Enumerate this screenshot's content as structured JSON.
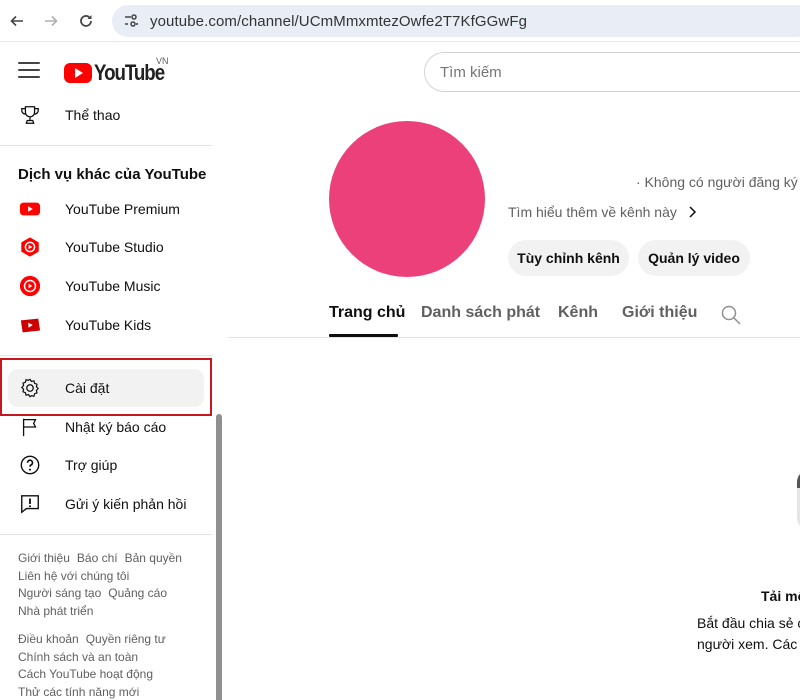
{
  "browser": {
    "url": "youtube.com/channel/UCmMmxmtezOwfe2T7KfGGwFg"
  },
  "masthead": {
    "logo_text": "YouTube",
    "country_code": "VN",
    "search_placeholder": "Tìm kiếm"
  },
  "sidebar": {
    "top_items": [
      {
        "label": "Thể thao",
        "icon": "trophy-icon"
      }
    ],
    "section_title": "Dịch vụ khác của YouTube",
    "services": [
      {
        "label": "YouTube Premium",
        "icon": "youtube-premium-icon"
      },
      {
        "label": "YouTube Studio",
        "icon": "youtube-studio-icon"
      },
      {
        "label": "YouTube Music",
        "icon": "youtube-music-icon"
      },
      {
        "label": "YouTube Kids",
        "icon": "youtube-kids-icon"
      }
    ],
    "settings_items": [
      {
        "label": "Cài đặt",
        "icon": "gear-icon",
        "active": true
      },
      {
        "label": "Nhật ký báo cáo",
        "icon": "flag-icon"
      },
      {
        "label": "Trợ giúp",
        "icon": "help-icon"
      },
      {
        "label": "Gửi ý kiến phản hồi",
        "icon": "feedback-icon"
      }
    ],
    "footer_primary": [
      [
        "Giới thiệu",
        "Báo chí",
        "Bản quyền"
      ],
      [
        "Liên hệ với chúng tôi"
      ],
      [
        "Người sáng tạo",
        "Quảng cáo"
      ],
      [
        "Nhà phát triển"
      ]
    ],
    "footer_secondary": [
      [
        "Điều khoản",
        "Quyền riêng tư"
      ],
      [
        "Chính sách và an toàn"
      ],
      [
        "Cách YouTube hoạt động"
      ],
      [
        "Thử các tính năng mới"
      ]
    ],
    "highlight_color": "#c5171d"
  },
  "channel": {
    "avatar_color": "#ec407a",
    "subscribers": "· Không có người đăng ký ·",
    "more_about": "Tìm hiểu thêm về kênh này",
    "customize_button": "Tùy chỉnh kênh",
    "manage_button": "Quản lý video"
  },
  "tabs": [
    {
      "label": "Trang chủ",
      "active": true
    },
    {
      "label": "Danh sách phát"
    },
    {
      "label": "Kênh"
    },
    {
      "label": "Giới thiệu"
    }
  ],
  "empty_state": {
    "title": "Tải mộ",
    "line1": "Bắt đầu chia sẻ c",
    "line2": "người xem. Các v"
  }
}
